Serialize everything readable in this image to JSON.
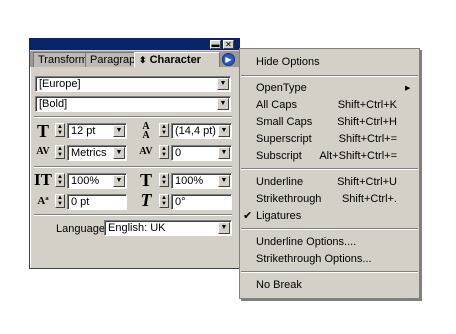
{
  "panel": {
    "tabs": [
      "Transform",
      "Paragraph",
      "Character"
    ],
    "active_tab_prefix": "⬍",
    "font_family": "[Europe]",
    "font_style": "[Bold]",
    "font_size": "12 pt",
    "leading": "(14,4 pt)",
    "kerning": "Metrics",
    "tracking": "0",
    "vertical_scale": "100%",
    "horizontal_scale": "100%",
    "baseline_shift": "0 pt",
    "skew": "0°",
    "language_label": "Language:",
    "language_value": "English: UK"
  },
  "menu": {
    "hide_options": "Hide Options",
    "opentype": "OpenType",
    "all_caps": {
      "label": "All Caps",
      "shortcut": "Shift+Ctrl+K"
    },
    "small_caps": {
      "label": "Small Caps",
      "shortcut": "Shift+Ctrl+H"
    },
    "superscript": {
      "label": "Superscript",
      "shortcut": "Shift+Ctrl+="
    },
    "subscript": {
      "label": "Subscript",
      "shortcut": "Alt+Shift+Ctrl+="
    },
    "underline": {
      "label": "Underline",
      "shortcut": "Shift+Ctrl+U"
    },
    "strikethrough": {
      "label": "Strikethrough",
      "shortcut": "Shift+Ctrl+."
    },
    "ligatures": {
      "label": "Ligatures",
      "checked": true
    },
    "underline_options": "Underline Options....",
    "strikethrough_options": "Strikethrough Options...",
    "no_break": "No Break"
  },
  "colors": {
    "title_bar": "#0a246a",
    "face": "#d4d0c8",
    "menu_button": "#2b57c7"
  }
}
